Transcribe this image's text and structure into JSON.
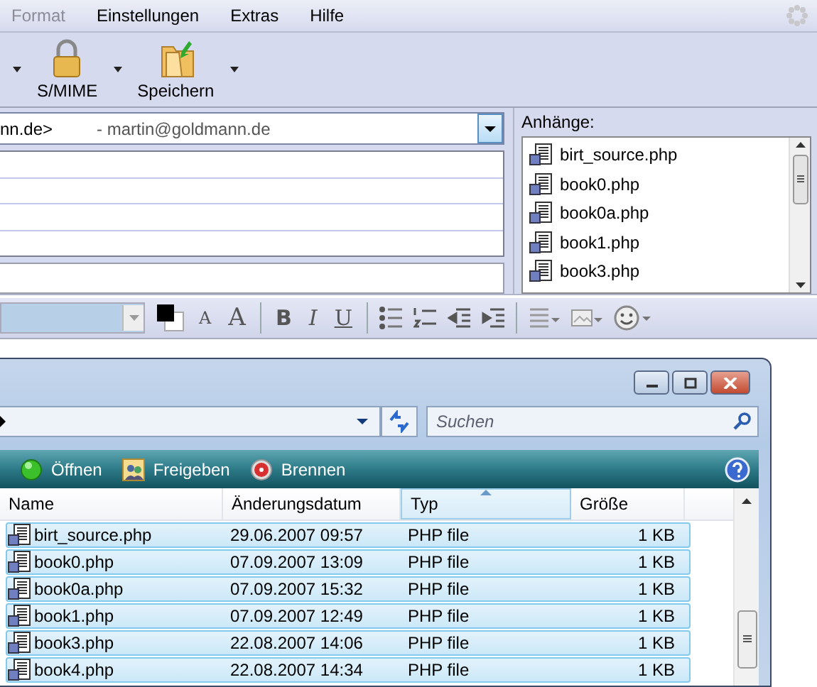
{
  "menu": [
    {
      "label": "Format",
      "disabled": true
    },
    {
      "label": "Einstellungen",
      "disabled": false
    },
    {
      "label": "Extras",
      "disabled": false
    },
    {
      "label": "Hilfe",
      "disabled": false
    }
  ],
  "toolbar": [
    {
      "label": "S/MIME",
      "kind": "lock"
    },
    {
      "label": "Speichern",
      "kind": "save"
    }
  ],
  "from_field": {
    "account": "nn.de>",
    "identity": "- martin@goldmann.de"
  },
  "attachments": {
    "label": "Anhänge:",
    "items": [
      "birt_source.php",
      "book0.php",
      "book0a.php",
      "book1.php",
      "book3.php"
    ]
  },
  "format_bar": {
    "glyph_buttons": [
      {
        "kind": "shrink",
        "glyph": "A"
      },
      {
        "kind": "grow",
        "glyph": "A"
      },
      {
        "kind": "bold",
        "glyph": "B"
      },
      {
        "kind": "italic",
        "glyph": "I"
      },
      {
        "kind": "underline",
        "glyph": "U"
      }
    ]
  },
  "explorer": {
    "search": {
      "placeholder": "Suchen"
    },
    "commands": [
      {
        "label": "Öffnen",
        "kind": "open"
      },
      {
        "label": "Freigeben",
        "kind": "share"
      },
      {
        "label": "Brennen",
        "kind": "burn"
      }
    ],
    "columns": [
      {
        "label": "Name",
        "sorted": false
      },
      {
        "label": "Änderungsdatum",
        "sorted": false
      },
      {
        "label": "Typ",
        "sorted": true
      },
      {
        "label": "Größe",
        "sorted": false
      }
    ],
    "rows": [
      {
        "name": "birt_source.php",
        "date": "29.06.2007 09:57",
        "type": "PHP file",
        "size": "1 KB",
        "selected": true
      },
      {
        "name": "book0.php",
        "date": "07.09.2007 13:09",
        "type": "PHP file",
        "size": "1 KB",
        "selected": true
      },
      {
        "name": "book0a.php",
        "date": "07.09.2007 15:32",
        "type": "PHP file",
        "size": "1 KB",
        "selected": true
      },
      {
        "name": "book1.php",
        "date": "07.09.2007 12:49",
        "type": "PHP file",
        "size": "1 KB",
        "selected": true
      },
      {
        "name": "book3.php",
        "date": "22.08.2007 14:06",
        "type": "PHP file",
        "size": "1 KB",
        "selected": true
      },
      {
        "name": "book4.php",
        "date": "22.08.2007 14:34",
        "type": "PHP file",
        "size": "1 KB",
        "selected": true
      }
    ]
  }
}
